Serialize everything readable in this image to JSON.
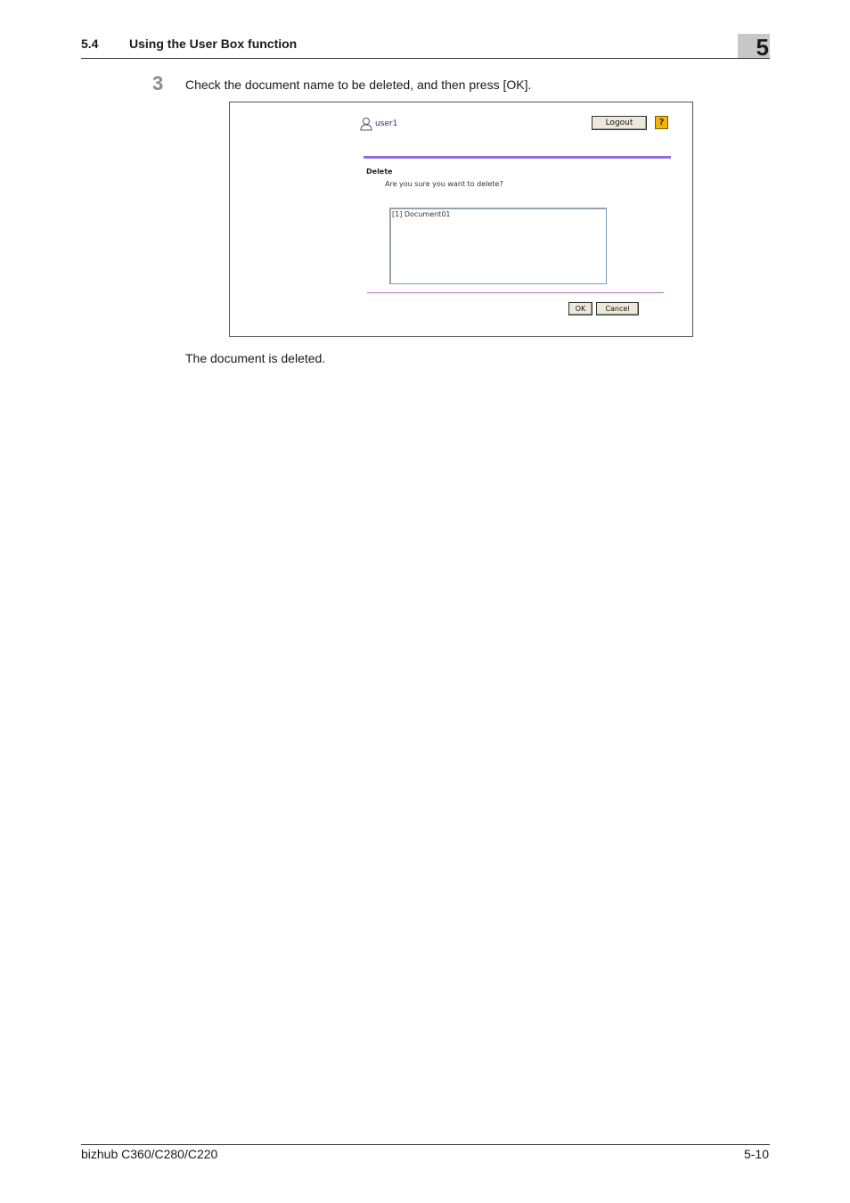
{
  "header": {
    "section_number": "5.4",
    "section_title": "Using the User Box function",
    "chapter_number": "5"
  },
  "step": {
    "number": "3",
    "instruction": "Check the document name to be deleted, and then press [OK]."
  },
  "screenshot": {
    "user_name": "user1",
    "logout_label": "Logout",
    "help_label": "?",
    "delete_heading": "Delete",
    "delete_question": "Are you sure you want to delete?",
    "documents": [
      "[1] Document01"
    ],
    "ok_label": "OK",
    "cancel_label": "Cancel",
    "icons": {
      "user": "user-icon",
      "help": "help-icon"
    },
    "colors": {
      "accent_bar": "#8e6fe0",
      "separator": "#b07bb8",
      "user_link": "#1a2d8f",
      "help_bg": "#f4b400"
    }
  },
  "result": "The document is deleted.",
  "footer": {
    "product": "bizhub C360/C280/C220",
    "page_number": "5-10"
  }
}
